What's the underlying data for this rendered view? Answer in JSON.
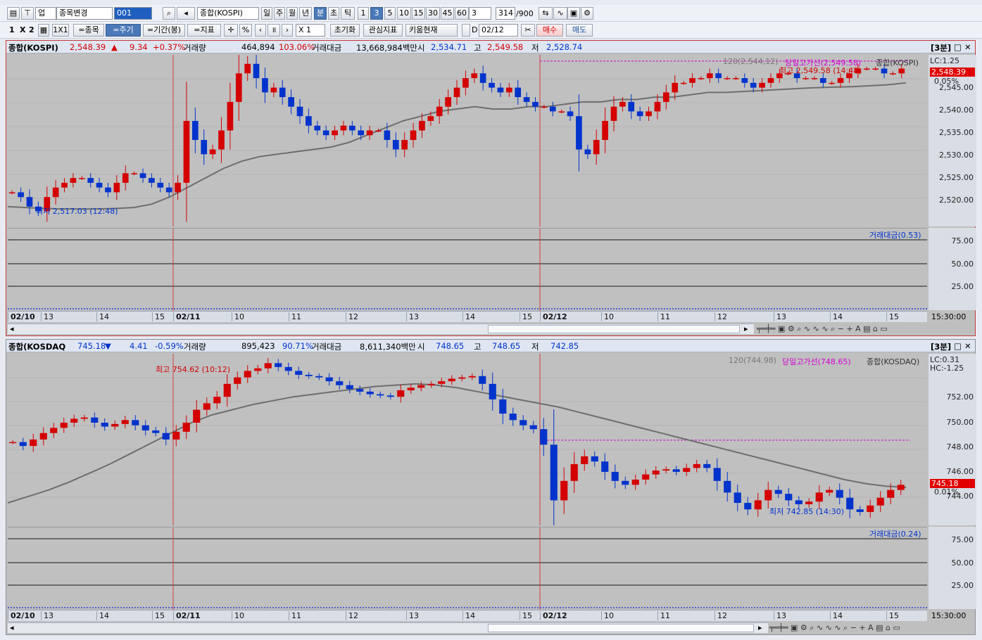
{
  "toolbar1": {
    "market": "업",
    "stock_change": "종목변경",
    "code": "001",
    "name": "종합(KOSPI)",
    "periods": [
      "일",
      "주",
      "월",
      "년",
      "분",
      "초",
      "틱"
    ],
    "active_period": "분",
    "minutes": [
      "1",
      "3",
      "5",
      "10",
      "15",
      "30",
      "45",
      "60"
    ],
    "active_minute": "3",
    "interval": "3",
    "count": "314",
    "count_total": "/900"
  },
  "toolbar2": {
    "layout_1": "1",
    "layout_x": "X",
    "layout_2": "2",
    "layout_1x1": "1X1",
    "same_stock": "=종목",
    "same_period": "=주기",
    "same_range": "=기간(봉)",
    "same_indicator": "=지표",
    "percent": "%",
    "zoom": "X 1",
    "reset": "초기화",
    "watch_indicator": "관심지표",
    "kiwoom_now": "키움현재",
    "date_label": "D",
    "date": "02/12",
    "buy": "매수",
    "sell": "매도"
  },
  "colors": {
    "up": "#d40000",
    "down": "#0033cc",
    "ma": "#6e6e6e",
    "high_line": "#d400d4",
    "divider": "#d04040"
  },
  "kospi": {
    "name": "종합(KOSPI)",
    "price": "2,548.39",
    "arrow": "▲",
    "change": "9.34",
    "change_pct": "+0.37%",
    "vol_label": "거래량",
    "volume": "464,894",
    "vol_ratio": "103.06%",
    "amt_label": "거래대금",
    "amount": "13,668,984백만",
    "open_label": "시",
    "open": "2,534.71",
    "high_label": "고",
    "high": "2,549.58",
    "low_label": "저",
    "low": "2,528.74",
    "period_badge": "[3분]",
    "legend_ma": "120(2,544,12)",
    "legend_high": "당일고가선(2,549.58)",
    "legend_name": "종합(KOSPI)",
    "lc": "LC:1.25",
    "cur_tag": "2,548.39",
    "cur_pct": "0.05%",
    "max_label": "최고 2,549.58 (14:48)",
    "min_label": "최저 2,517.03 (12:48)",
    "ylabels": [
      "2,545.00",
      "2,540.00",
      "2,535.00",
      "2,530.00",
      "2,525.00",
      "2,520.00"
    ],
    "vol_title": "거래대금(0.53)",
    "vol_ylabels": [
      "75.00",
      "50.00",
      "25.00"
    ],
    "time_end": "15:30:00"
  },
  "kosdaq": {
    "name": "종합(KOSDAQ",
    "price": "745.18",
    "arrow": "▼",
    "change": "4.41",
    "change_pct": "-0.59%",
    "vol_label": "거래량",
    "volume": "895,423",
    "vol_ratio": "90.71%",
    "amt_label": "거래대금",
    "amount": "8,611,340백만",
    "open_label": "시",
    "open": "748.65",
    "high_label": "고",
    "high": "748.65",
    "low_label": "저",
    "low": "742.85",
    "period_badge": "[3분]",
    "legend_ma": "120(744.98)",
    "legend_high": "당일고가선(748.65)",
    "legend_name": "종합(KOSDAQ)",
    "lc": "LC:0.31",
    "hc": "HC:-1.25",
    "cur_tag": "745.18",
    "cur_pct": "0.01%",
    "max_label": "최고 754.62 (10:12)",
    "min_label": "최저 742.85 (14:30)",
    "ylabels": [
      "752.00",
      "750.00",
      "748.00",
      "746.00",
      "744.00"
    ],
    "vol_title": "거래대금(0.24)",
    "vol_ylabels": [
      "75.00",
      "50.00",
      "25.00"
    ],
    "time_end": "15:30:00"
  },
  "xlabels": [
    "02/10",
    "13",
    "14",
    "15",
    "02/11",
    "10",
    "11",
    "12",
    "13",
    "14",
    "15",
    "02/12",
    "10",
    "11",
    "12",
    "13",
    "14",
    "15"
  ],
  "chart_data": [
    {
      "type": "candlestick",
      "title": "종합(KOSPI) 3분",
      "x_sessions": [
        "02/10",
        "02/11",
        "02/12"
      ],
      "ylim": [
        2516,
        2550
      ],
      "close_series": [
        2522,
        2521,
        2519,
        2518,
        2521,
        2523,
        2524,
        2525,
        2525,
        2524,
        2523,
        2522,
        2524,
        2526,
        2526,
        2525,
        2524,
        2523,
        2522,
        2524,
        2537,
        2533,
        2530,
        2531,
        2535,
        2541,
        2547,
        2549,
        2546,
        2543,
        2544,
        2542,
        2540,
        2538,
        2536,
        2535,
        2534,
        2535,
        2536,
        2535,
        2534,
        2535,
        2535,
        2533,
        2531,
        2533,
        2535,
        2537,
        2538,
        2540,
        2542,
        2544,
        2546,
        2547,
        2545,
        2544,
        2543,
        2544,
        2542,
        2541,
        2540,
        2540,
        2539,
        2539,
        2538,
        2531,
        2530,
        2533,
        2537,
        2540,
        2541,
        2539,
        2538,
        2539,
        2541,
        2543,
        2545,
        2545,
        2546,
        2546,
        2547,
        2546,
        2546,
        2546,
        2545,
        2544,
        2545,
        2546,
        2547,
        2547,
        2546,
        2546,
        2546,
        2545,
        2545,
        2546,
        2547,
        2548,
        2548,
        2548,
        2547,
        2547,
        2548
      ],
      "ma120": [
        2519,
        2518.8,
        2518.6,
        2518.5,
        2518.5,
        2518.5,
        2518.6,
        2518.8,
        2519.5,
        2521,
        2523,
        2525,
        2527,
        2528.5,
        2529.5,
        2530,
        2530.5,
        2531,
        2531.5,
        2532.5,
        2534,
        2535.5,
        2537,
        2538,
        2539,
        2539.5,
        2540,
        2539.5,
        2539.5,
        2540,
        2540,
        2540.5,
        2541,
        2541,
        2541.5,
        2541.5,
        2542,
        2542,
        2542.5,
        2543,
        2543,
        2543.2,
        2543.4,
        2543.6,
        2543.8,
        2544,
        2544.1,
        2544.2,
        2544.4,
        2544.6,
        2545
      ],
      "day_high": 2549.58,
      "day_low": 2517.03,
      "current": 2548.39
    },
    {
      "type": "candlestick",
      "title": "종합(KOSDAQ) 3분",
      "x_sessions": [
        "02/10",
        "02/11",
        "02/12"
      ],
      "ylim": [
        742.5,
        755
      ],
      "close_series": [
        748.5,
        748.2,
        748.7,
        749.2,
        749.6,
        750,
        750.3,
        750.4,
        750,
        749.7,
        749.9,
        750.2,
        749.8,
        749.4,
        749.2,
        748.7,
        749.3,
        750,
        751,
        751.5,
        752,
        753,
        753.5,
        754,
        754.2,
        754.6,
        754.3,
        754,
        753.7,
        753.6,
        753.5,
        753.2,
        752.9,
        752.6,
        752.4,
        752.2,
        752.1,
        752,
        752.5,
        752.7,
        752.9,
        753,
        753.2,
        753.4,
        753.5,
        753.6,
        753,
        751.8,
        750.7,
        750.2,
        749.8,
        749.5,
        748.3,
        744,
        745.5,
        746.8,
        747.4,
        747,
        746.2,
        745.5,
        745.2,
        745.6,
        746,
        746.3,
        746.4,
        746.2,
        746.5,
        746.8,
        746.5,
        745.5,
        744.6,
        743.8,
        743.3,
        744,
        744.8,
        744.5,
        744,
        743.7,
        743.9,
        744.6,
        744.8,
        744.2,
        743.3,
        743.1,
        743.6,
        744.2,
        744.8,
        745.2
      ],
      "ma120": [
        743.8,
        744.3,
        744.8,
        745.4,
        746.1,
        746.8,
        747.6,
        748.4,
        749.2,
        750,
        750.6,
        751,
        751.4,
        751.7,
        752,
        752.2,
        752.4,
        752.6,
        752.8,
        752.9,
        753,
        752.9,
        752.7,
        752.4,
        752.1,
        751.8,
        751.5,
        751.2,
        750.8,
        750.4,
        750,
        749.6,
        749.2,
        748.8,
        748.4,
        748,
        747.6,
        747.2,
        746.8,
        746.4,
        746,
        745.6,
        745.3,
        745.1,
        745
      ],
      "day_high": 748.65,
      "day_low": 742.85,
      "current": 745.18
    }
  ]
}
